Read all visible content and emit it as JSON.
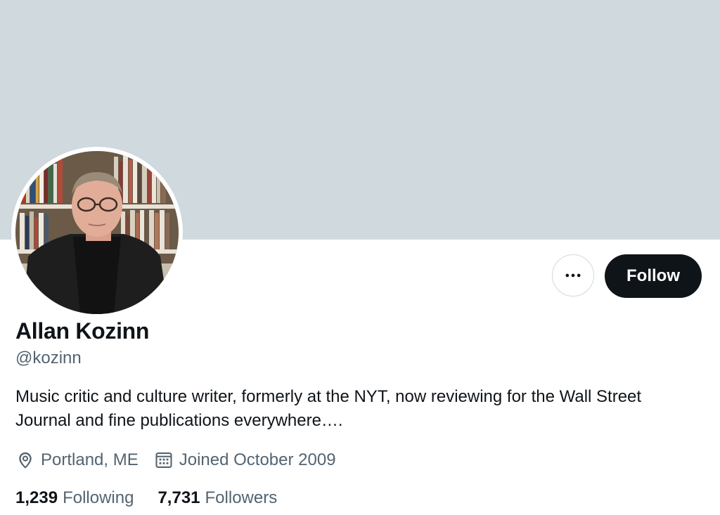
{
  "profile": {
    "display_name": "Allan Kozinn",
    "handle": "@kozinn",
    "bio_line1": "Music critic and culture writer, formerly at the NYT, now reviewing for the Wall Street",
    "bio_line2": "Journal and fine publications everywhere….",
    "location": "Portland, ME",
    "joined": "Joined October 2009"
  },
  "stats": {
    "following_count": "1,239",
    "following_label": "Following",
    "followers_count": "7,731",
    "followers_label": "Followers"
  },
  "actions": {
    "more_icon": "more-horizontal-icon",
    "follow_label": "Follow"
  },
  "icons": {
    "location": "location-pin-icon",
    "calendar": "calendar-icon"
  },
  "colors": {
    "banner": "#cfd9de",
    "primary_text": "#0f1419",
    "secondary_text": "#536471",
    "follow_button_bg": "#0f1419"
  }
}
